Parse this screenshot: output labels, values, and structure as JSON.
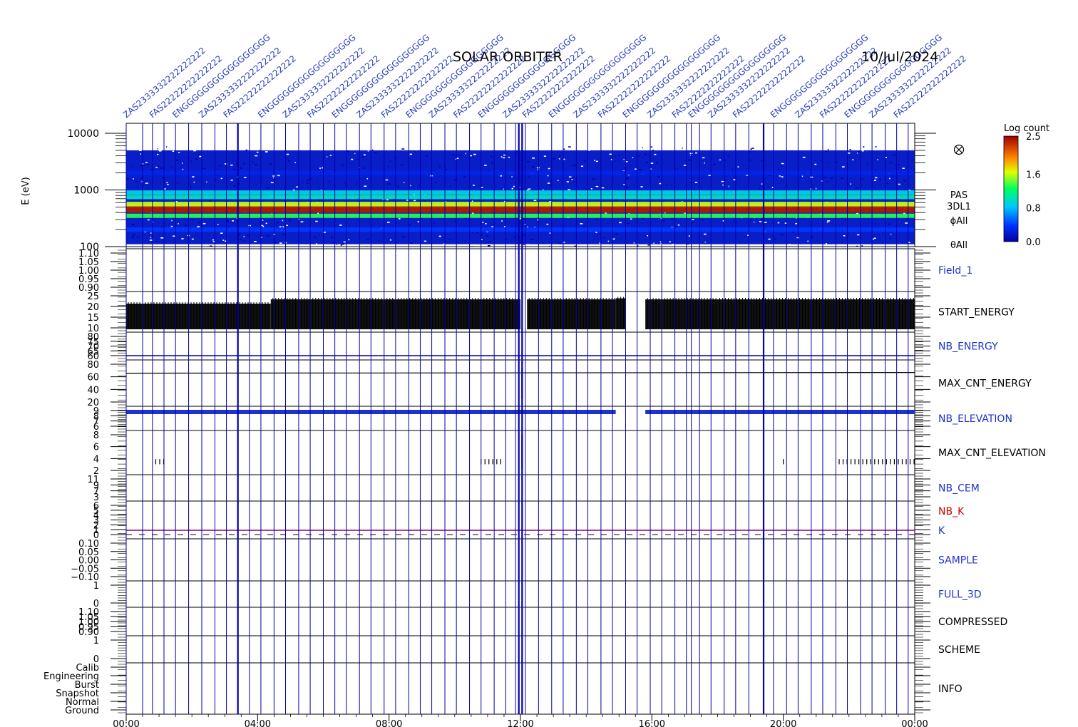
{
  "header": {
    "mission": "SOLAR ORBITER",
    "date": "10/Jul/2024",
    "event_label_text": "ZAS2333332222222222",
    "event_label_text2": "ENGGGGGGGGGGGGGGGGG",
    "event_label_text3": "FAS22222222222222"
  },
  "colorbar": {
    "title": "Log count",
    "ticks": [
      "2.5",
      "1.6",
      "0.8",
      "0.0"
    ],
    "min": 0.0,
    "max": 2.5
  },
  "colors": {
    "axis": "#000000",
    "event_line": "#0000aa",
    "blue_trace": "#1e33cc",
    "red_label": "#cc0000",
    "k_line": "#800080"
  },
  "chart_data": [
    {
      "id": "spectrogram",
      "type": "heatmap",
      "ylabel": "E (eV)",
      "yscale": "log",
      "ylim": [
        100,
        15000
      ],
      "yticks": [
        "10000",
        "1000",
        "100"
      ],
      "ytick_values": [
        10000,
        1000,
        100
      ],
      "side_labels": [
        "PAS",
        "3DL1",
        "ϕAll",
        "θAll"
      ],
      "bands": [
        {
          "energy_eV": 900,
          "level": 0.9
        },
        {
          "energy_eV": 750,
          "level": 1.0
        },
        {
          "energy_eV": 550,
          "level": 1.6
        },
        {
          "energy_eV": 450,
          "level": 2.4
        },
        {
          "energy_eV": 350,
          "level": 1.3
        },
        {
          "energy_eV": 200,
          "level": 0.4
        },
        {
          "energy_eV": 2000,
          "level": 0.3
        }
      ],
      "noise_range_eV": [
        110,
        5000
      ]
    },
    {
      "id": "field1",
      "type": "line",
      "label": "Field_1",
      "label_color": "blue",
      "yticks": [
        "1.10",
        "1.05",
        "1.00",
        "0.95",
        "0.90"
      ]
    },
    {
      "id": "start_energy",
      "type": "bar",
      "label": "START_ENERGY",
      "label_color": "black",
      "yticks": [
        "25",
        "20",
        "15",
        "10"
      ],
      "ylim": [
        10,
        25
      ],
      "segments": [
        {
          "from_h": 0,
          "to_h": 4.4,
          "value": 22
        },
        {
          "from_h": 4.4,
          "to_h": 12.0,
          "value": 24
        },
        {
          "from_h": 12.0,
          "to_h": 12.2,
          "value": 10
        },
        {
          "from_h": 12.2,
          "to_h": 14.9,
          "value": 24
        },
        {
          "from_h": 14.9,
          "to_h": 15.2,
          "value": 24.5
        },
        {
          "from_h": 15.8,
          "to_h": 18.0,
          "value": 24
        },
        {
          "from_h": 18.0,
          "to_h": 24.0,
          "value": 24
        }
      ]
    },
    {
      "id": "nb_energy",
      "type": "line",
      "label": "NB_ENERGY",
      "label_color": "blue",
      "yticks": [
        "80",
        "75",
        "70",
        "65",
        "60"
      ],
      "value": 64
    },
    {
      "id": "max_cnt_energy",
      "type": "line",
      "label": "MAX_CNT_ENERGY",
      "label_color": "black",
      "yticks": [
        "80",
        "60",
        "40",
        "20"
      ],
      "ylim": [
        0,
        85
      ],
      "value": 62
    },
    {
      "id": "nb_elevation",
      "type": "line",
      "label": "NB_ELEVATION",
      "label_color": "blue",
      "yticks": [
        "9",
        "8",
        "7",
        "6"
      ],
      "value": 8.8
    },
    {
      "id": "max_cnt_elevation",
      "type": "bar",
      "label": "MAX_CNT_ELEVATION",
      "label_color": "black",
      "yticks": [
        "8",
        "6",
        "4",
        "2"
      ],
      "ylim": [
        1,
        9.5
      ],
      "spikes_h": [
        [
          0.9,
          1.2
        ],
        [
          10.8,
          11.5
        ],
        [
          20.0,
          20.1
        ],
        [
          21.7,
          24.0
        ]
      ]
    },
    {
      "id": "nb_cem",
      "type": "line",
      "label": "NB_CEM",
      "label_color": "blue",
      "yticks": [
        "11",
        "9",
        "7",
        "3"
      ]
    },
    {
      "id": "nb_k",
      "type": "line",
      "label": "NB_K",
      "label2": "K",
      "label_color": "red",
      "yticks": [
        "6",
        "5",
        "4",
        "3",
        "2",
        "1",
        "0"
      ],
      "value": 1
    },
    {
      "id": "sample",
      "type": "line",
      "label": "SAMPLE",
      "label_color": "blue",
      "yticks": [
        "0.10",
        "0.05",
        "0.00",
        "−0.05",
        "−0.10"
      ]
    },
    {
      "id": "full_3d",
      "type": "line",
      "label": "FULL_3D",
      "label_color": "blue",
      "yticks": [
        "1",
        "0"
      ]
    },
    {
      "id": "compressed",
      "type": "line",
      "label": "COMPRESSED",
      "label_color": "black",
      "yticks": [
        "1.10",
        "1.05",
        "1.00",
        "0.95",
        "0.90"
      ]
    },
    {
      "id": "scheme",
      "type": "line",
      "label": "SCHEME",
      "label_color": "black",
      "yticks": [
        "1",
        "0"
      ]
    },
    {
      "id": "info",
      "type": "line",
      "label": "INFO",
      "label_color": "black",
      "yticks": [
        "Calib",
        "Engineering",
        "Burst",
        "Snapshot",
        "Normal",
        "Ground"
      ]
    }
  ],
  "xaxis": {
    "range_h": [
      0,
      24
    ],
    "ticks": [
      "00:00",
      "04:00",
      "08:00",
      "12:00",
      "16:00",
      "20:00",
      "00:00"
    ],
    "tick_values_h": [
      0,
      4,
      8,
      12,
      16,
      20,
      24
    ]
  },
  "events": {
    "thick_h": [
      3.4,
      11.95,
      12.05,
      19.4
    ],
    "thin_h": [
      0.0,
      0.5,
      0.8,
      1.15,
      1.5,
      1.9,
      2.3,
      2.7,
      3.05,
      3.75,
      4.1,
      4.5,
      4.85,
      5.25,
      5.6,
      6.0,
      6.35,
      6.7,
      7.1,
      7.45,
      7.85,
      8.2,
      8.6,
      8.95,
      9.3,
      9.7,
      10.05,
      10.45,
      10.8,
      11.2,
      11.55,
      11.85,
      12.15,
      12.55,
      12.95,
      13.3,
      13.7,
      14.05,
      14.45,
      14.8,
      15.2,
      15.55,
      15.95,
      16.3,
      16.7,
      17.05,
      17.2,
      17.45,
      17.8,
      18.2,
      18.55,
      18.95,
      19.7,
      20.1,
      20.45,
      20.85,
      21.2,
      21.6,
      21.95,
      22.35,
      22.7,
      23.1,
      23.45,
      23.8
    ]
  }
}
